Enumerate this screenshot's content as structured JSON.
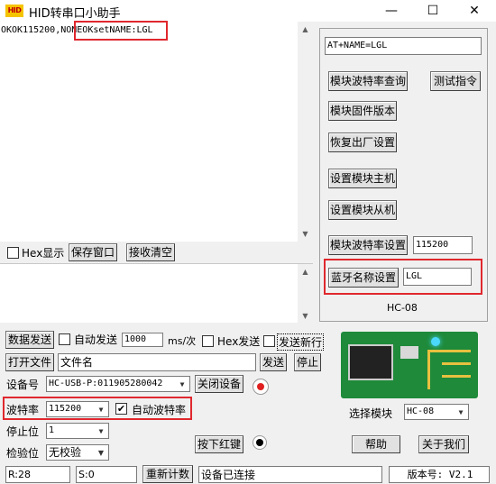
{
  "window": {
    "app_icon_text": "HID",
    "title": "HID转串口小助手",
    "minimize": "—",
    "maximize": "☐",
    "close": "✕"
  },
  "receive": {
    "text": "OKOK115200,NONEOKsetNAME:LGL",
    "highlight": "OKsetNAME:LGL"
  },
  "bottom_left": {
    "hex_display_label": "Hex显示",
    "save_window": "保存窗口",
    "clear_receive": "接收清空",
    "send_data": "数据发送",
    "auto_send_label": "自动发送",
    "interval_value": "1000",
    "interval_unit": "ms/次",
    "hex_send_label": "Hex发送",
    "send_newline_label": "发送新行",
    "open_file": "打开文件",
    "file_name_value": "文件名",
    "send_button": "发送",
    "stop_button": "停止",
    "device_label": "设备号",
    "device_value": "HC-USB-P:011905280042",
    "close_device": "关闭设备",
    "baud_label": "波特率",
    "baud_value": "115200",
    "auto_baud_label": "自动波特率",
    "auto_baud_checked": true,
    "stop_bits_label": "停止位",
    "stop_bits_value": "1",
    "parity_label": "检验位",
    "parity_value": "无校验",
    "red_key_button": "按下红键"
  },
  "right_panel": {
    "at_command_value": "AT+NAME=LGL",
    "query_baud": "模块波特率查询",
    "test_command": "测试指令",
    "firmware_version": "模块固件版本",
    "factory_reset": "恢复出厂设置",
    "set_master": "设置模块主机",
    "set_slave": "设置模块从机",
    "set_baud": "模块波特率设置",
    "baud_field_value": "115200",
    "set_bt_name": "蓝牙名称设置",
    "bt_name_value": "LGL",
    "module_model": "HC-08",
    "select_module_label": "选择模块",
    "select_module_value": "HC-08",
    "help_button": "帮助",
    "about_button": "关于我们"
  },
  "status_bar": {
    "rx_count": "R:28",
    "tx_count": "S:0",
    "recount_button": "重新计数",
    "connection_status": "设备已连接",
    "version": "版本号: V2.1"
  },
  "colors": {
    "highlight_red": "#e0282e",
    "board_green": "#1e8a3a",
    "led_red": "#e02020"
  }
}
